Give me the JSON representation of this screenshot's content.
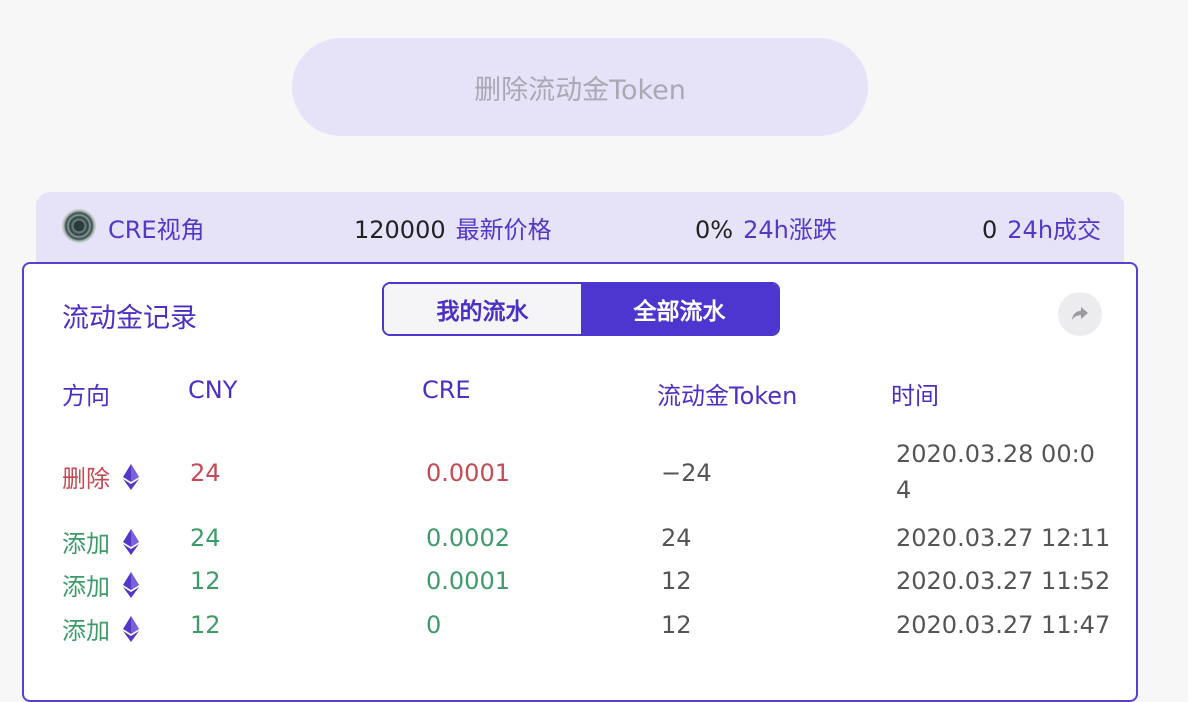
{
  "remove_button": {
    "label": "删除流动金Token"
  },
  "stats": {
    "coin_name": "CRE视角",
    "price_value": "120000",
    "price_label": "最新价格",
    "change_value": "0%",
    "change_label": "24h涨跌",
    "volume_value": "0",
    "volume_label": "24h成交"
  },
  "card": {
    "title": "流动金记录",
    "tabs": [
      {
        "label": "我的流水",
        "active": false
      },
      {
        "label": "全部流水",
        "active": true
      }
    ],
    "share_icon": "share-arrow-icon",
    "columns": [
      "方向",
      "CNY",
      "CRE",
      "流动金Token",
      "时间"
    ],
    "rows": [
      {
        "direction": "删除",
        "icon": "ethereum-icon",
        "cny": "24",
        "cre": "0.0001",
        "token": "−24",
        "time": "2020.03.28 00:04"
      },
      {
        "direction": "添加",
        "icon": "ethereum-icon",
        "cny": "24",
        "cre": "0.0002",
        "token": "24",
        "time": "2020.03.27 12:11"
      },
      {
        "direction": "添加",
        "icon": "ethereum-icon",
        "cny": "12",
        "cre": "0.0001",
        "token": "12",
        "time": "2020.03.27 11:52"
      },
      {
        "direction": "添加",
        "icon": "ethereum-icon",
        "cny": "12",
        "cre": "0",
        "token": "12",
        "time": "2020.03.27 11:47"
      }
    ]
  },
  "colors": {
    "accent": "#4d35cf",
    "remove": "#c64a55",
    "add": "#3e9b6a",
    "panel": "#e6e3f8"
  }
}
